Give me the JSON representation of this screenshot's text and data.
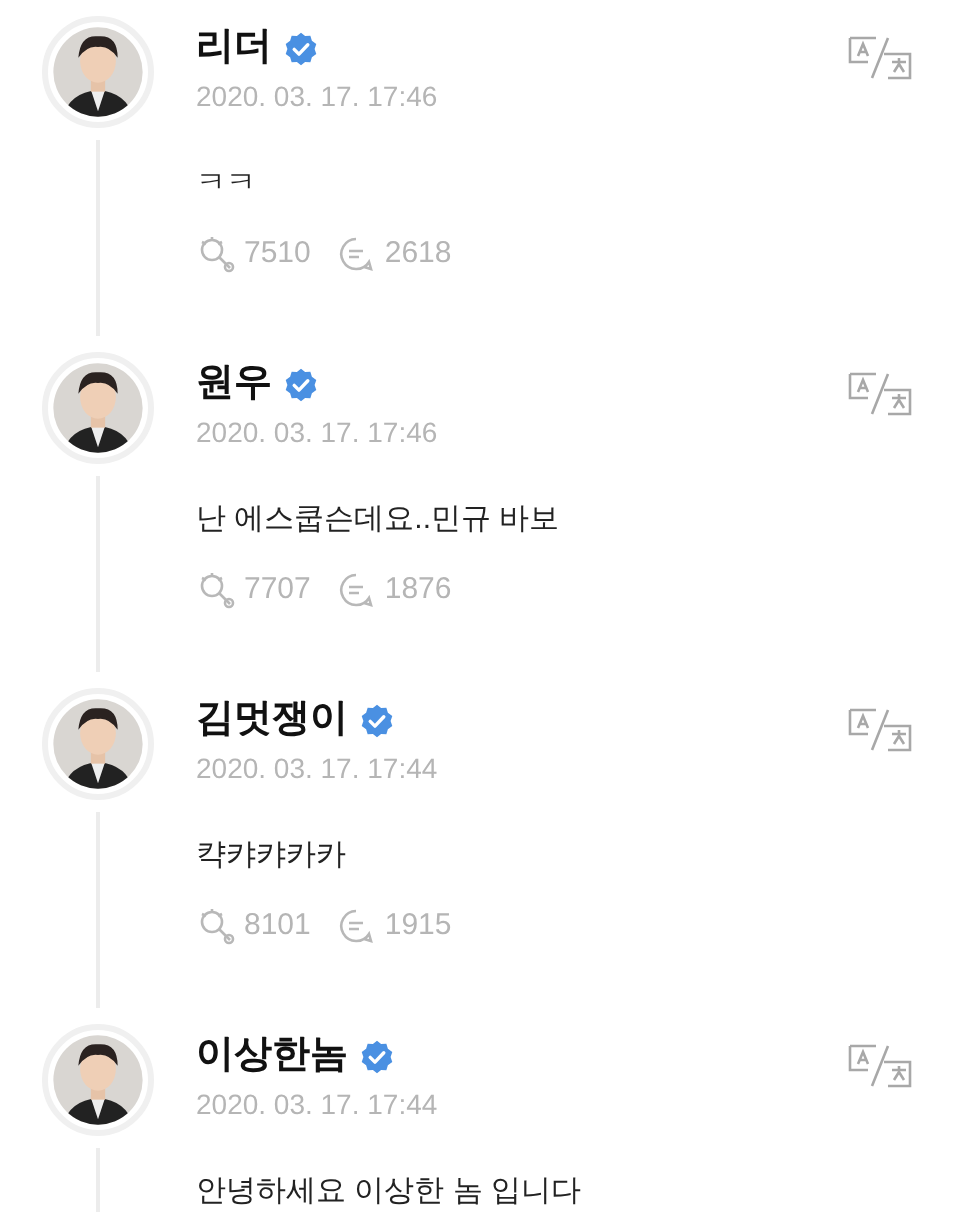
{
  "posts": [
    {
      "author": "리더",
      "verified": true,
      "time": "2020. 03. 17. 17:46",
      "text": "ㅋㅋ",
      "likes": "7510",
      "comments": "2618"
    },
    {
      "author": "원우",
      "verified": true,
      "time": "2020. 03. 17. 17:46",
      "text": "난 에스쿱슨데요..민규 바보",
      "likes": "7707",
      "comments": "1876"
    },
    {
      "author": "김멋쟁이",
      "verified": true,
      "time": "2020. 03. 17. 17:44",
      "text": "캭캬캬카카",
      "likes": "8101",
      "comments": "1915"
    },
    {
      "author": "이상한놈",
      "verified": true,
      "time": "2020. 03. 17. 17:44",
      "text": "안녕하세요 이상한 놈 입니다"
    }
  ]
}
